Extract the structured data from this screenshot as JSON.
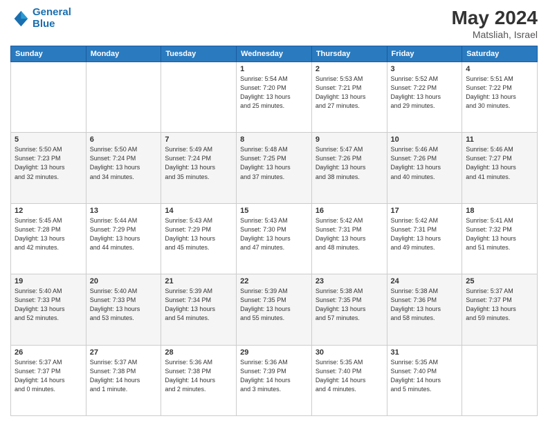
{
  "header": {
    "logo_line1": "General",
    "logo_line2": "Blue",
    "month_year": "May 2024",
    "location": "Matsliah, Israel"
  },
  "weekdays": [
    "Sunday",
    "Monday",
    "Tuesday",
    "Wednesday",
    "Thursday",
    "Friday",
    "Saturday"
  ],
  "weeks": [
    [
      {
        "num": "",
        "info": ""
      },
      {
        "num": "",
        "info": ""
      },
      {
        "num": "",
        "info": ""
      },
      {
        "num": "1",
        "info": "Sunrise: 5:54 AM\nSunset: 7:20 PM\nDaylight: 13 hours\nand 25 minutes."
      },
      {
        "num": "2",
        "info": "Sunrise: 5:53 AM\nSunset: 7:21 PM\nDaylight: 13 hours\nand 27 minutes."
      },
      {
        "num": "3",
        "info": "Sunrise: 5:52 AM\nSunset: 7:22 PM\nDaylight: 13 hours\nand 29 minutes."
      },
      {
        "num": "4",
        "info": "Sunrise: 5:51 AM\nSunset: 7:22 PM\nDaylight: 13 hours\nand 30 minutes."
      }
    ],
    [
      {
        "num": "5",
        "info": "Sunrise: 5:50 AM\nSunset: 7:23 PM\nDaylight: 13 hours\nand 32 minutes."
      },
      {
        "num": "6",
        "info": "Sunrise: 5:50 AM\nSunset: 7:24 PM\nDaylight: 13 hours\nand 34 minutes."
      },
      {
        "num": "7",
        "info": "Sunrise: 5:49 AM\nSunset: 7:24 PM\nDaylight: 13 hours\nand 35 minutes."
      },
      {
        "num": "8",
        "info": "Sunrise: 5:48 AM\nSunset: 7:25 PM\nDaylight: 13 hours\nand 37 minutes."
      },
      {
        "num": "9",
        "info": "Sunrise: 5:47 AM\nSunset: 7:26 PM\nDaylight: 13 hours\nand 38 minutes."
      },
      {
        "num": "10",
        "info": "Sunrise: 5:46 AM\nSunset: 7:26 PM\nDaylight: 13 hours\nand 40 minutes."
      },
      {
        "num": "11",
        "info": "Sunrise: 5:46 AM\nSunset: 7:27 PM\nDaylight: 13 hours\nand 41 minutes."
      }
    ],
    [
      {
        "num": "12",
        "info": "Sunrise: 5:45 AM\nSunset: 7:28 PM\nDaylight: 13 hours\nand 42 minutes."
      },
      {
        "num": "13",
        "info": "Sunrise: 5:44 AM\nSunset: 7:29 PM\nDaylight: 13 hours\nand 44 minutes."
      },
      {
        "num": "14",
        "info": "Sunrise: 5:43 AM\nSunset: 7:29 PM\nDaylight: 13 hours\nand 45 minutes."
      },
      {
        "num": "15",
        "info": "Sunrise: 5:43 AM\nSunset: 7:30 PM\nDaylight: 13 hours\nand 47 minutes."
      },
      {
        "num": "16",
        "info": "Sunrise: 5:42 AM\nSunset: 7:31 PM\nDaylight: 13 hours\nand 48 minutes."
      },
      {
        "num": "17",
        "info": "Sunrise: 5:42 AM\nSunset: 7:31 PM\nDaylight: 13 hours\nand 49 minutes."
      },
      {
        "num": "18",
        "info": "Sunrise: 5:41 AM\nSunset: 7:32 PM\nDaylight: 13 hours\nand 51 minutes."
      }
    ],
    [
      {
        "num": "19",
        "info": "Sunrise: 5:40 AM\nSunset: 7:33 PM\nDaylight: 13 hours\nand 52 minutes."
      },
      {
        "num": "20",
        "info": "Sunrise: 5:40 AM\nSunset: 7:33 PM\nDaylight: 13 hours\nand 53 minutes."
      },
      {
        "num": "21",
        "info": "Sunrise: 5:39 AM\nSunset: 7:34 PM\nDaylight: 13 hours\nand 54 minutes."
      },
      {
        "num": "22",
        "info": "Sunrise: 5:39 AM\nSunset: 7:35 PM\nDaylight: 13 hours\nand 55 minutes."
      },
      {
        "num": "23",
        "info": "Sunrise: 5:38 AM\nSunset: 7:35 PM\nDaylight: 13 hours\nand 57 minutes."
      },
      {
        "num": "24",
        "info": "Sunrise: 5:38 AM\nSunset: 7:36 PM\nDaylight: 13 hours\nand 58 minutes."
      },
      {
        "num": "25",
        "info": "Sunrise: 5:37 AM\nSunset: 7:37 PM\nDaylight: 13 hours\nand 59 minutes."
      }
    ],
    [
      {
        "num": "26",
        "info": "Sunrise: 5:37 AM\nSunset: 7:37 PM\nDaylight: 14 hours\nand 0 minutes."
      },
      {
        "num": "27",
        "info": "Sunrise: 5:37 AM\nSunset: 7:38 PM\nDaylight: 14 hours\nand 1 minute."
      },
      {
        "num": "28",
        "info": "Sunrise: 5:36 AM\nSunset: 7:38 PM\nDaylight: 14 hours\nand 2 minutes."
      },
      {
        "num": "29",
        "info": "Sunrise: 5:36 AM\nSunset: 7:39 PM\nDaylight: 14 hours\nand 3 minutes."
      },
      {
        "num": "30",
        "info": "Sunrise: 5:35 AM\nSunset: 7:40 PM\nDaylight: 14 hours\nand 4 minutes."
      },
      {
        "num": "31",
        "info": "Sunrise: 5:35 AM\nSunset: 7:40 PM\nDaylight: 14 hours\nand 5 minutes."
      },
      {
        "num": "",
        "info": ""
      }
    ]
  ]
}
